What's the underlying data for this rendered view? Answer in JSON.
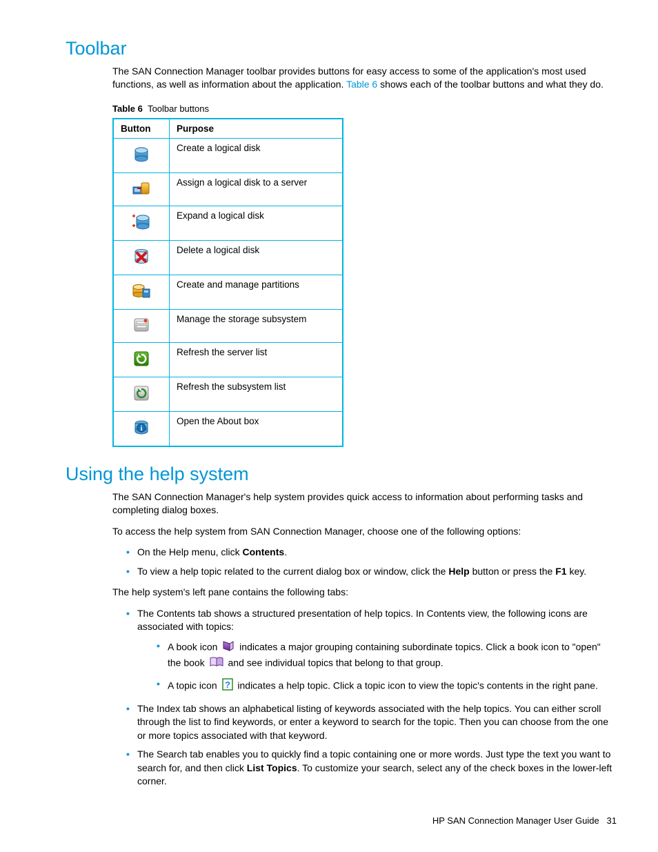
{
  "headings": {
    "toolbar": "Toolbar",
    "help": "Using the help system"
  },
  "toolbar_intro_pre": "The SAN Connection Manager toolbar provides buttons for easy access to some of the application's most used functions, as well as information about the application. ",
  "toolbar_intro_xref": "Table 6",
  "toolbar_intro_post": " shows each of the toolbar buttons and what they do.",
  "table_caption_label": "Table 6",
  "table_caption_text": "Toolbar buttons",
  "table_headers": {
    "button": "Button",
    "purpose": "Purpose"
  },
  "table_rows": [
    {
      "icon": "create-disk-icon",
      "purpose": "Create a logical disk"
    },
    {
      "icon": "assign-disk-icon",
      "purpose": "Assign a logical disk to a server"
    },
    {
      "icon": "expand-disk-icon",
      "purpose": "Expand a logical disk"
    },
    {
      "icon": "delete-disk-icon",
      "purpose": "Delete a logical disk"
    },
    {
      "icon": "partitions-icon",
      "purpose": "Create and manage partitions"
    },
    {
      "icon": "manage-storage-icon",
      "purpose": "Manage the storage subsystem"
    },
    {
      "icon": "refresh-server-icon",
      "purpose": "Refresh the server list"
    },
    {
      "icon": "refresh-subsystem-icon",
      "purpose": "Refresh the subsystem list"
    },
    {
      "icon": "about-icon",
      "purpose": "Open the About box"
    }
  ],
  "help_p1": "The SAN Connection Manager's help system provides quick access to information about performing tasks and completing dialog boxes.",
  "help_p2": "To access the help system from SAN Connection Manager, choose one of the following options:",
  "help_b1_pre": "On the Help menu, click ",
  "help_b1_bold": "Contents",
  "help_b1_post": ".",
  "help_b2_pre": "To view a help topic related to the current dialog box or window, click the ",
  "help_b2_bold1": "Help",
  "help_b2_mid": " button or press the ",
  "help_b2_bold2": "F1",
  "help_b2_post": " key.",
  "help_p3": "The help system's left pane contains the following tabs:",
  "help_b3": "The Contents tab shows a structured presentation of help topics. In Contents view, the following icons are associated with topics:",
  "help_b3a_pre": "A book icon ",
  "help_b3a_mid": " indicates a major grouping containing subordinate topics. Click a book icon to \"open\" the book ",
  "help_b3a_post": " and see individual topics that belong to that group.",
  "help_b3b_pre": "A topic icon ",
  "help_b3b_post": " indicates a help topic. Click a topic icon to view the topic's contents in the right pane.",
  "help_b4": "The Index tab shows an alphabetical listing of keywords associated with the help topics. You can either scroll through the list to find keywords, or enter a keyword to search for the topic. Then you can choose from the one or more topics associated with that keyword.",
  "help_b5_pre": "The Search tab enables you to quickly find a topic containing one or more words. Just type the text you want to search for, and then click ",
  "help_b5_bold": "List Topics",
  "help_b5_post": ". To customize your search, select any of the check boxes in the lower-left corner.",
  "footer_title": "HP SAN Connection Manager User Guide",
  "footer_page": "31"
}
